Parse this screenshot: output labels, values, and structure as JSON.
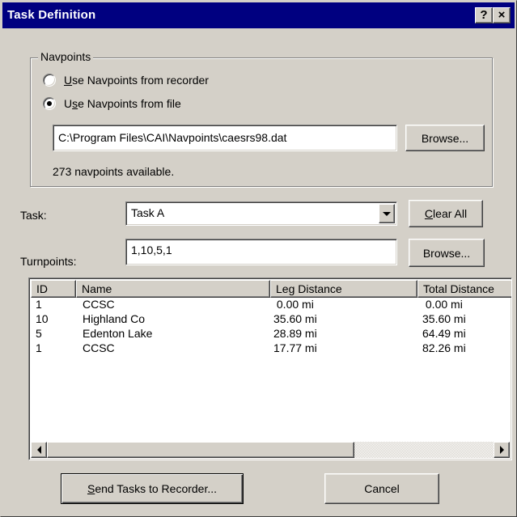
{
  "window": {
    "title": "Task Definition",
    "help_glyph": "?",
    "close_glyph": "×"
  },
  "navpoints": {
    "group_label": "Navpoints",
    "recorder_option": {
      "accel": "U",
      "rest": "se Navpoints from recorder",
      "selected": false
    },
    "file_option": {
      "pre": "U",
      "accel": "s",
      "rest": "e Navpoints from file",
      "selected": true
    },
    "file_path": "C:\\Program Files\\CAI\\Navpoints\\caesrs98.dat",
    "browse_label": "Browse...",
    "available_text": "273 navpoints available."
  },
  "task": {
    "label": "Task:",
    "selected": "Task A",
    "clear_accel": "C",
    "clear_rest": "lear All"
  },
  "turnpoints": {
    "label": "Turnpoints:",
    "value": "1,10,5,1",
    "browse_label": "Browse..."
  },
  "table": {
    "columns": [
      "ID",
      "Name",
      "Leg Distance",
      "Total Distance"
    ],
    "rows": [
      {
        "id": "1",
        "name": "CCSC",
        "leg": " 0.00 mi",
        "total": " 0.00 mi"
      },
      {
        "id": "10",
        "name": "Highland Co",
        "leg": "35.60 mi",
        "total": "35.60 mi"
      },
      {
        "id": "5",
        "name": "Edenton Lake",
        "leg": "28.89 mi",
        "total": "64.49 mi"
      },
      {
        "id": "1",
        "name": "CCSC",
        "leg": "17.77 mi",
        "total": "82.26 mi"
      }
    ]
  },
  "footer": {
    "send_accel": "S",
    "send_rest": "end Tasks to Recorder...",
    "cancel_label": "Cancel"
  }
}
